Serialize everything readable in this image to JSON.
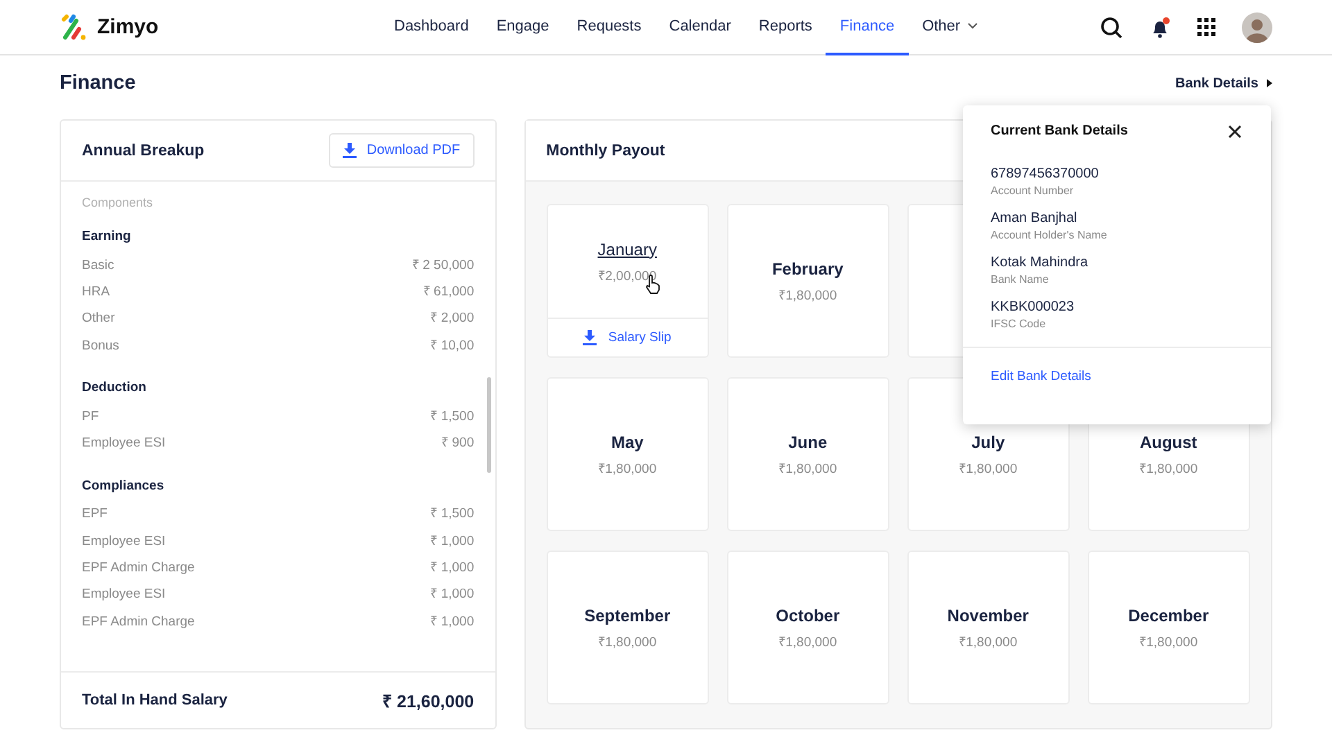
{
  "brand": "Zimyo",
  "nav": [
    {
      "label": "Dashboard",
      "selected": false
    },
    {
      "label": "Engage",
      "selected": false
    },
    {
      "label": "Requests",
      "selected": false
    },
    {
      "label": "Calendar",
      "selected": false
    },
    {
      "label": "Reports",
      "selected": false
    },
    {
      "label": "Finance",
      "selected": true
    },
    {
      "label": "Other",
      "selected": false,
      "dropdown": true
    }
  ],
  "notification_unread": true,
  "page_title": "Finance",
  "bank_details_link": "Bank Details",
  "annual": {
    "title": "Annual Breakup",
    "download": "Download PDF",
    "components_label": "Components",
    "sections": [
      {
        "title": "Earning",
        "rows": [
          {
            "name": "Basic",
            "amount": "₹ 2 50,000"
          },
          {
            "name": "HRA",
            "amount": "₹ 61,000"
          },
          {
            "name": "Other",
            "amount": "₹ 2,000"
          },
          {
            "name": "Bonus",
            "amount": "₹ 10,00"
          }
        ]
      },
      {
        "title": "Deduction",
        "rows": [
          {
            "name": "PF",
            "amount": "₹ 1,500"
          },
          {
            "name": "Employee ESI",
            "amount": "₹ 900"
          }
        ]
      },
      {
        "title": "Compliances",
        "rows": [
          {
            "name": "EPF",
            "amount": "₹ 1,500"
          },
          {
            "name": "Employee ESI",
            "amount": "₹ 1,000"
          },
          {
            "name": "EPF Admin Charge",
            "amount": "₹ 1,000"
          },
          {
            "name": "Employee ESI",
            "amount": "₹ 1,000"
          },
          {
            "name": "EPF Admin Charge",
            "amount": "₹ 1,000"
          }
        ]
      }
    ],
    "total_label": "Total In Hand Salary",
    "total": "₹ 21,60,000"
  },
  "monthly": {
    "title": "Monthly Payout",
    "rows": [
      [
        {
          "kind": "month",
          "name": "January",
          "amount": "₹2,00,000",
          "hovered": true,
          "slip": "Salary Slip"
        },
        {
          "kind": "month",
          "name": "February",
          "amount": "₹1,80,000",
          "hovered": false
        },
        {
          "kind": "covered"
        }
      ],
      [
        {
          "kind": "month",
          "name": "May",
          "amount": "₹1,80,000",
          "hovered": false
        },
        {
          "kind": "month",
          "name": "June",
          "amount": "₹1,80,000",
          "hovered": false
        },
        {
          "kind": "month",
          "name": "July",
          "amount": "₹1,80,000",
          "hovered": false
        },
        {
          "kind": "month",
          "name": "August",
          "amount": "₹1,80,000",
          "hovered": false
        }
      ],
      [
        {
          "kind": "month",
          "name": "September",
          "amount": "₹1,80,000",
          "hovered": false
        },
        {
          "kind": "month",
          "name": "October",
          "amount": "₹1,80,000",
          "hovered": false
        },
        {
          "kind": "month",
          "name": "November",
          "amount": "₹1,80,000",
          "hovered": false
        },
        {
          "kind": "month",
          "name": "December",
          "amount": "₹1,80,000",
          "hovered": false
        }
      ]
    ]
  },
  "bank_popup": {
    "title": "Current Bank Details",
    "fields": [
      {
        "value": "67897456370000",
        "label": "Account Number"
      },
      {
        "value": "Aman Banjhal",
        "label": "Account Holder's Name"
      },
      {
        "value": "Kotak Mahindra",
        "label": "Bank Name"
      },
      {
        "value": "KKBK000023",
        "label": "IFSC Code"
      }
    ],
    "edit": "Edit Bank Details"
  }
}
